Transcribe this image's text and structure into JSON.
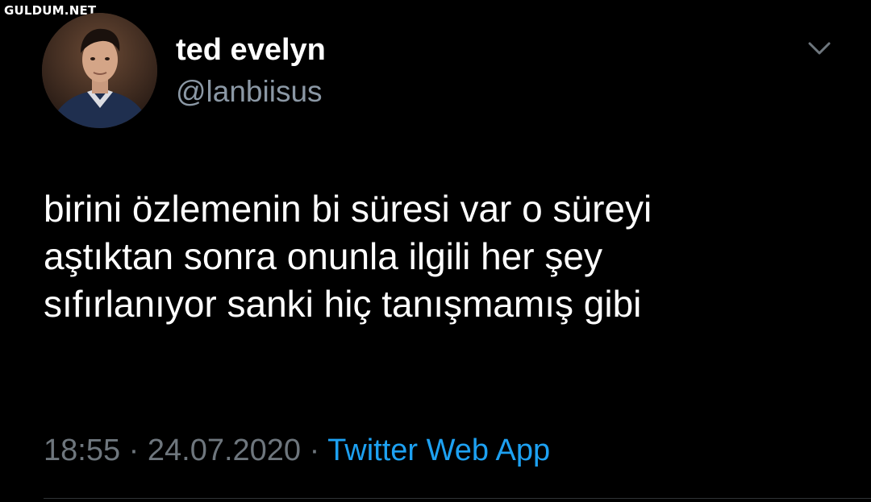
{
  "watermark": {
    "text": "GULDUM.NET"
  },
  "tweet": {
    "author": {
      "display_name": "ted evelyn",
      "handle": "@lanbiisus",
      "avatar": "profile-photo"
    },
    "menu_icon": "chevron-down-icon",
    "text_lines": [
      "birini özlemenin bi süresi var o süreyi",
      "aştıktan sonra onunla ilgili her şey",
      "sıfırlanıyor sanki hiç tanışmamış gibi"
    ],
    "time": "18:55",
    "date": "24.07.2020",
    "separator": "·",
    "source": "Twitter Web App"
  },
  "colors": {
    "background": "#000000",
    "primary_text": "#ffffff",
    "secondary_text": "#8b98a5",
    "meta_text": "#6e767d",
    "link": "#1da1f2"
  }
}
